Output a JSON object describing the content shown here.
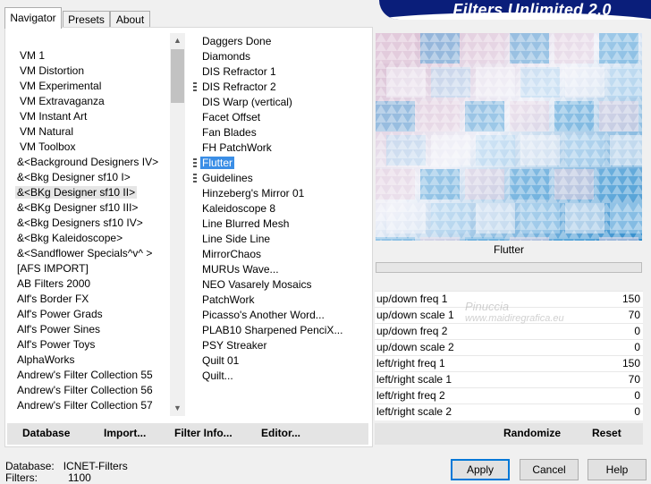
{
  "window": {
    "title": "Filters Unlimited 2.0"
  },
  "tabs": [
    {
      "label": "Navigator",
      "active": true
    },
    {
      "label": "Presets",
      "active": false
    },
    {
      "label": "About",
      "active": false
    }
  ],
  "categories": [
    "VM 1",
    "VM Distortion",
    "VM Experimental",
    "VM Extravaganza",
    "VM Instant Art",
    "VM Natural",
    "VM Toolbox",
    "&<Background Designers IV>",
    "&<Bkg Designer sf10 I>",
    "&<BKg Designer sf10 II>",
    "&<BKg Designer sf10 III>",
    "&<Bkg Designers sf10 IV>",
    "&<Bkg Kaleidoscope>",
    "&<Sandflower Specials^v^ >",
    "[AFS IMPORT]",
    "AB Filters 2000",
    "Alf's Border FX",
    "Alf's Power Grads",
    "Alf's Power Sines",
    "Alf's Power Toys",
    "AlphaWorks",
    "Andrew's Filter Collection 55",
    "Andrew's Filter Collection 56",
    "Andrew's Filter Collection 57"
  ],
  "selected_category": "&<BKg Designer sf10 II>",
  "filters": [
    "Daggers Done",
    "Diamonds",
    "DIS Refractor 1",
    "DIS Refractor 2",
    "DIS Warp (vertical)",
    "Facet Offset",
    "Fan Blades",
    "FH PatchWork",
    "Flutter",
    "Guidelines",
    "Hinzeberg's Mirror 01",
    "Kaleidoscope 8",
    "Line Blurred Mesh",
    "Line Side Line",
    "MirrorChaos",
    "MURUs Wave...",
    "NEO Vasarely Mosaics",
    "PatchWork",
    "Picasso's Another Word...",
    "PLAB10 Sharpened PenciX...",
    "PSY Streaker",
    "Quilt 01",
    "Quilt..."
  ],
  "selected_filter": "Flutter",
  "preview": {
    "filter_name": "Flutter"
  },
  "params": [
    {
      "label": "up/down freq 1",
      "value": "150"
    },
    {
      "label": "up/down scale 1",
      "value": "70"
    },
    {
      "label": "up/down freq 2",
      "value": "0"
    },
    {
      "label": "up/down scale 2",
      "value": "0"
    },
    {
      "label": "left/right freq 1",
      "value": "150"
    },
    {
      "label": "left/right scale 1",
      "value": "70"
    },
    {
      "label": "left/right freq 2",
      "value": "0"
    },
    {
      "label": "left/right scale 2",
      "value": "0"
    }
  ],
  "bottom_buttons": {
    "database": "Database",
    "import": "Import...",
    "filter_info": "Filter Info...",
    "editor": "Editor...",
    "randomize": "Randomize",
    "reset": "Reset"
  },
  "status": {
    "database_label": "Database:",
    "database_value": "ICNET-Filters",
    "filters_label": "Filters:",
    "filters_value": "1100"
  },
  "dialog_buttons": {
    "apply": "Apply",
    "cancel": "Cancel",
    "help": "Help"
  },
  "watermark": {
    "line1": "Pinuccia",
    "line2": "www.maidiregrafica.eu"
  },
  "colors": {
    "title_bar": "#0a1e7a",
    "selection": "#3b8ee6"
  }
}
